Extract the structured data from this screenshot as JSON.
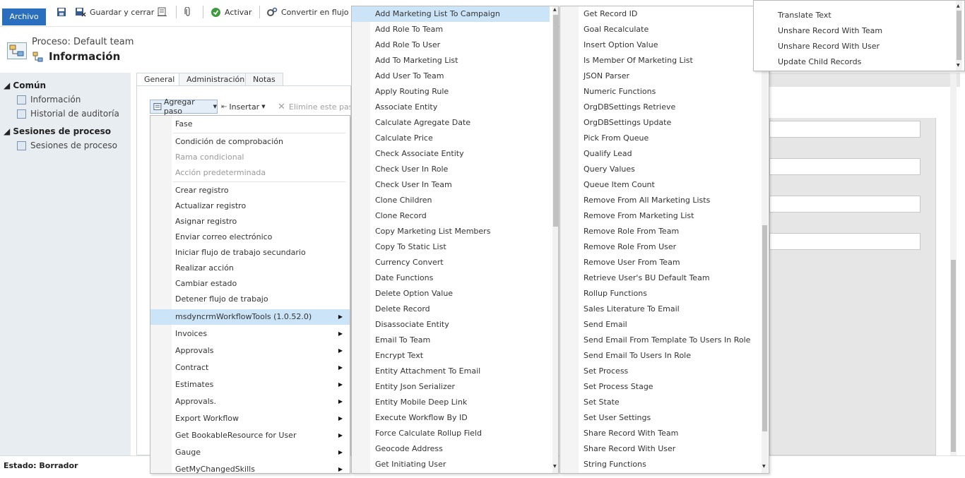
{
  "ribbon": {
    "archivo": "Archivo",
    "save_close": "Guardar y cerrar",
    "activate": "Activar",
    "convert": "Convertir en flujo de"
  },
  "header": {
    "process_label": "Proceso: Default team",
    "title": "Información"
  },
  "nav": {
    "common": "Común",
    "info": "Información",
    "audit": "Historial de auditoría",
    "sessions_header": "Sesiones de proceso",
    "sessions": "Sesiones de proceso"
  },
  "tabs": [
    "General",
    "Administración",
    "Notas"
  ],
  "toolbar": {
    "add_step": "Agregar paso",
    "insert": "Insertar",
    "delete": "Elimine este paso"
  },
  "status": "Estado: Borrador",
  "menu1": {
    "group1": [
      "Fase"
    ],
    "group2": [
      "Condición de comprobación",
      "Rama condicional",
      "Acción predeterminada"
    ],
    "group2_disabled": [
      false,
      true,
      true
    ],
    "group3": [
      "Crear registro",
      "Actualizar registro",
      "Asignar registro",
      "Enviar correo electrónico",
      "Iniciar flujo de trabajo secundario",
      "Realizar acción",
      "Cambiar estado",
      "Detener flujo de trabajo"
    ],
    "submenus": [
      "msdyncrmWorkflowTools (1.0.52.0)",
      "Invoices",
      "Approvals",
      "Contract",
      "Estimates",
      "Approvals.",
      "Export Workflow",
      "Get BookableResource for User",
      "Gauge",
      "GetMyChangedSkills"
    ]
  },
  "menu2": {
    "items": [
      "Add Marketing List To Campaign",
      "Add Role To Team",
      "Add Role To User",
      "Add To Marketing List",
      "Add User To Team",
      "Apply Routing Rule",
      "Associate Entity",
      "Calculate Agregate Date",
      "Calculate Price",
      "Check Associate Entity",
      "Check User In Role",
      "Check User In Team",
      "Clone Children",
      "Clone Record",
      "Copy Marketing List Members",
      "Copy To Static List",
      "Currency Convert",
      "Date Functions",
      "Delete Option Value",
      "Delete Record",
      "Disassociate Entity",
      "Email To Team",
      "Encrypt Text",
      "Entity Attachment To Email",
      "Entity Json Serializer",
      "Entity Mobile Deep Link",
      "Execute Workflow By ID",
      "Force Calculate Rollup Field",
      "Geocode Address",
      "Get Initiating User"
    ]
  },
  "menu3": {
    "items": [
      "Get Record ID",
      "Goal Recalculate",
      "Insert Option Value",
      "Is Member Of Marketing List",
      "JSON Parser",
      "Numeric Functions",
      "OrgDBSettings Retrieve",
      "OrgDBSettings Update",
      "Pick From Queue",
      "Qualify Lead",
      "Query Values",
      "Queue Item Count",
      "Remove From All Marketing Lists",
      "Remove From Marketing List",
      "Remove Role From Team",
      "Remove Role From User",
      "Remove User From Team",
      "Retrieve User's BU Default Team",
      "Rollup Functions",
      "Sales Literature To Email",
      "Send Email",
      "Send Email From Template To Users In Role",
      "Send Email To Users In Role",
      "Set Process",
      "Set Process Stage",
      "Set State",
      "Set User Settings",
      "Share Record With Team",
      "Share Record With User",
      "String Functions"
    ]
  },
  "menu4": {
    "items": [
      "Translate Text",
      "Unshare Record With Team",
      "Unshare Record With User",
      "Update Child Records"
    ]
  },
  "colors": {
    "archivo_bg": "#2a6fbf",
    "highlight": "#cce4f7",
    "nav_bg": "#e8edf1"
  }
}
